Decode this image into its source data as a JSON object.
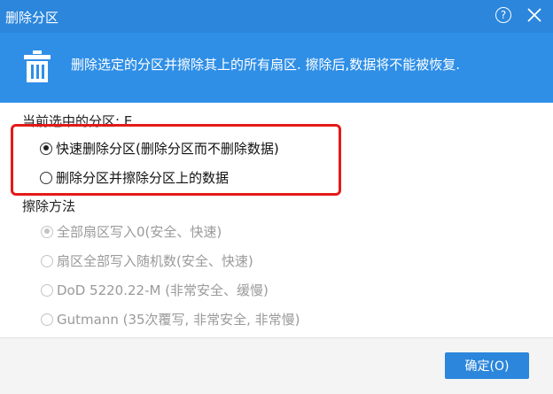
{
  "window": {
    "title": "删除分区",
    "help_glyph": "?"
  },
  "banner": {
    "icon": "trash-icon",
    "text": "删除选定的分区并擦除其上的所有扇区. 擦除后,数据将不能被恢复."
  },
  "current_partition": {
    "label": "当前选中的分区: E"
  },
  "delete_options": [
    {
      "label": "快速删除分区(删除分区而不删除数据)",
      "checked": true
    },
    {
      "label": "删除分区并擦除分区上的数据",
      "checked": false
    }
  ],
  "wipe_section": {
    "label": "擦除方法",
    "methods": [
      {
        "label": "全部扇区写入0(安全、快速)",
        "checked": true,
        "disabled": true
      },
      {
        "label": "扇区全部写入随机数(安全、快速)",
        "checked": false,
        "disabled": true
      },
      {
        "label": "DoD 5220.22-M (非常安全、缓慢)",
        "checked": false,
        "disabled": true
      },
      {
        "label": "Gutmann (35次覆写, 非常安全, 非常慢)",
        "checked": false,
        "disabled": true
      }
    ]
  },
  "footer": {
    "ok_label": "确定(O)"
  },
  "colors": {
    "titlebar": "#2b86dc",
    "banner": "#2f8fe7",
    "highlight": "#e31a1a"
  }
}
